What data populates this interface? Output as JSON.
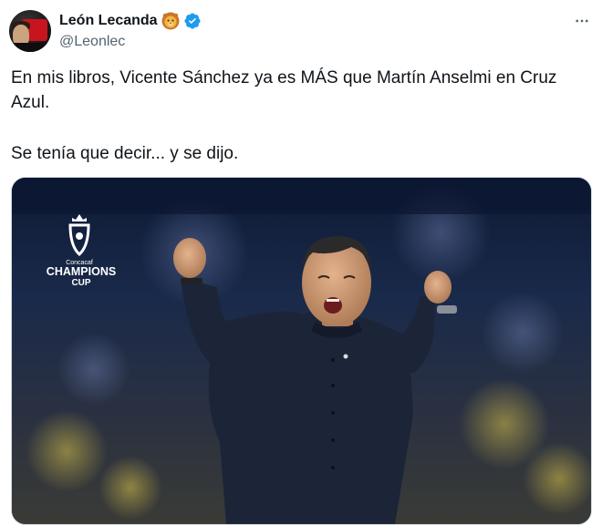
{
  "tweet": {
    "author_name": "León Lecanda",
    "author_emoji": "lion-face-emoji",
    "verified": true,
    "handle": "@Leonlec",
    "text_line1": "En mis libros, Vicente Sánchez ya es MÁS que Martín Anselmi en Cruz Azul.",
    "text_line2": "Se tenía que decir... y se dijo.",
    "menu_icon": "more-horizontal-icon"
  },
  "media": {
    "logo_brand": "Concacaf",
    "logo_title": "CHAMPIONS",
    "logo_subtitle": "CUP",
    "accent_color": "#1d9bf0"
  }
}
